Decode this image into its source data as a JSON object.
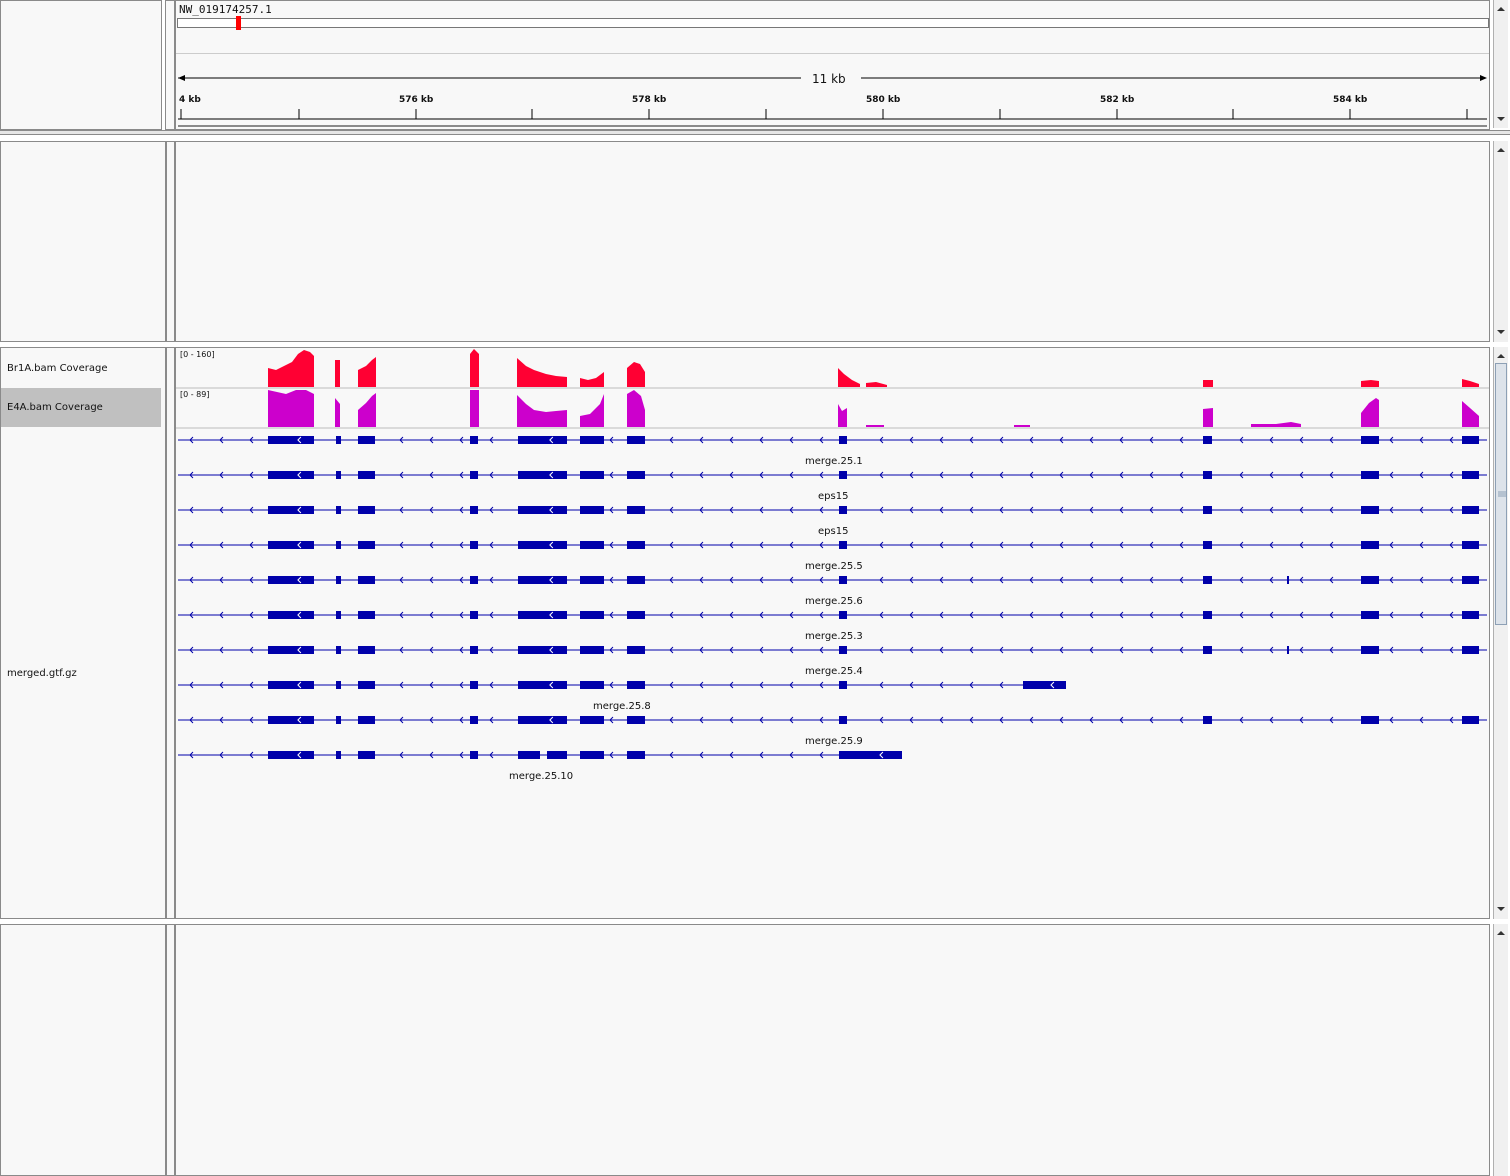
{
  "header": {
    "chromosome_label": "NW_019174257.1",
    "span_label": "11 kb",
    "ruler_ticks": [
      "4 kb",
      "576 kb",
      "578 kb",
      "580 kb",
      "582 kb",
      "584 kb"
    ]
  },
  "tracks": {
    "br1a": {
      "name": "Br1A.bam Coverage",
      "range": "[0 - 160]",
      "color": "#ff0033"
    },
    "e4a": {
      "name": "E4A.bam Coverage",
      "range": "[0 - 89]",
      "color": "#cc00cc"
    },
    "gtf": {
      "name": "merged.gtf.gz",
      "color": "#0000aa"
    }
  },
  "transcript_labels": [
    "merge.25.1",
    "eps15",
    "eps15",
    "merge.25.5",
    "merge.25.6",
    "merge.25.3",
    "merge.25.4",
    "merge.25.8",
    "merge.25.9",
    "merge.25.10"
  ],
  "colors": {
    "red_marker": "#ff0000",
    "feature_blue": "#0000aa",
    "selected_name_bg": "#c0c0c0"
  }
}
